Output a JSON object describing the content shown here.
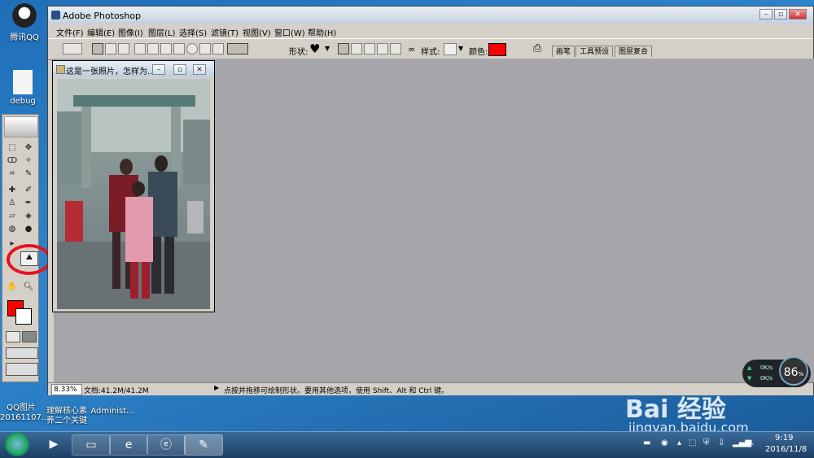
{
  "desktop": {
    "icons": [
      {
        "label": "腾讯QQ"
      },
      {
        "label": "debug"
      },
      {
        "label": "QQ图片 20161107..."
      },
      {
        "label": "理解核心素养二个关键"
      },
      {
        "label": "Administ..."
      }
    ]
  },
  "photoshop": {
    "title": "Adobe Photoshop",
    "menu": [
      "文件(F)",
      "编辑(E)",
      "图像(I)",
      "图层(L)",
      "选择(S)",
      "滤镜(T)",
      "视图(V)",
      "窗口(W)",
      "帮助(H)"
    ],
    "options": {
      "shape_label": "形状:",
      "style_label": "样式:",
      "color_label": "颜色:",
      "color_value": "#ff0000"
    },
    "palette_tabs": [
      "画笔",
      "工具预设",
      "图层复合"
    ],
    "document": {
      "title": "这是一张照片，怎样为..."
    },
    "status": {
      "zoom": "8.33%",
      "doc_size": "文档:41.2M/41.2M",
      "hint": "点按并拖移可绘制形状。要用其他选项，使用 Shift、Alt 和 Ctrl 键。"
    },
    "foreground_color": "#ff0000"
  },
  "speed_widget": {
    "up": "0K/s",
    "down": "0K/s",
    "percent": "86",
    "percent_unit": "%"
  },
  "watermark": {
    "brand": "Bai 经验",
    "url": "jingyan.baidu.com"
  },
  "taskbar": {
    "clock_time": "9:19",
    "clock_date": "2016/11/8"
  },
  "colors": {
    "accent": "#e8111f",
    "canvas": "#a6a6aa"
  }
}
